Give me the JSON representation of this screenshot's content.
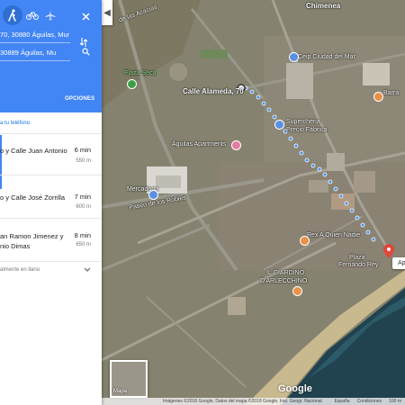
{
  "panel": {
    "modes": [
      {
        "name": "walking",
        "icon": "walk-icon",
        "active": true
      },
      {
        "name": "bicycling",
        "icon": "bike-icon",
        "active": false
      },
      {
        "name": "flights",
        "icon": "flight-icon",
        "active": false
      }
    ],
    "origin": "70, 30880 Águilas, Mur",
    "destination": "30889 Águilas, Mu",
    "options_label": "OPCIONES",
    "send_to_phone": "a tu teléfono",
    "routes": [
      {
        "name": "o y Calle Juan Antonio",
        "time": "6 min",
        "distance": "550 m"
      },
      {
        "name": "o y Calle José Zorrilla",
        "time": "7 min",
        "distance": "600 m"
      },
      {
        "name": "an Ramon Jimenez y\nnio Dimas",
        "time": "8 min",
        "distance": "650 m"
      }
    ],
    "terrain_note": "almente en llano"
  },
  "map": {
    "labels": {
      "chimenea": "Chimenea",
      "las_acacias": "de las Acacias",
      "plaza_seca": "Plaza Seca",
      "calle_alameda": "Calle Alameda, 70",
      "ceip": "Ceip Ciudad del Mar",
      "supercheria": "Supercheria",
      "precio_fabrica": "Precio Fábrica",
      "aguilas_apartments": "Águilas Apartments",
      "barra": "Barra",
      "mercadona": "Mercadona",
      "paseo_robles": "Paseo de los Robles",
      "rex": "Rex A Quien Nadie",
      "plaza_fernando": "Plaza",
      "plaza_fernando_2": "Fernando Rey",
      "giardino": "IL GIARDINO",
      "arlecchino": "D'ARLECCHINO",
      "mapa": "Mapa",
      "google": "Google",
      "dest_card": "Ap"
    },
    "attribution": {
      "text": "Imágenes ©2018 Google, Datos del mapa ©2018 Google, Inst. Geogr. Nacional",
      "country": "España",
      "terms": "Condiciones",
      "scale": "100 m"
    }
  },
  "colors": {
    "header_blue": "#4285f4",
    "route_dots": "#4a90e2",
    "active_mode": "#2f6fd3"
  }
}
